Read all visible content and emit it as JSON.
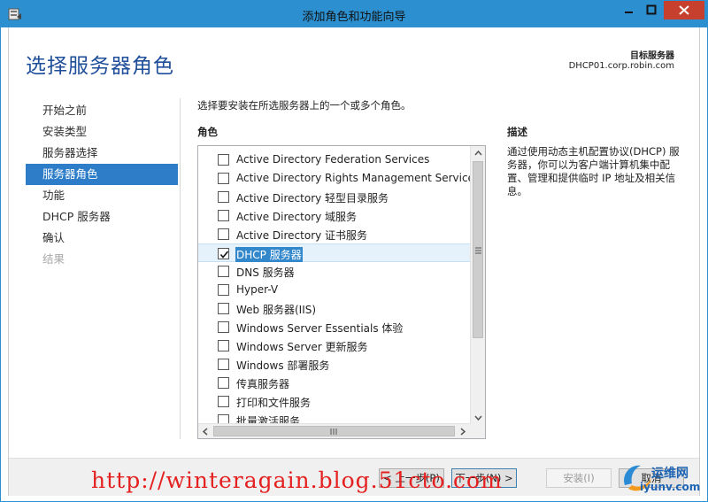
{
  "window": {
    "title": "添加角色和功能向导"
  },
  "header": {
    "page_title": "选择服务器角色",
    "target_label": "目标服务器",
    "target_server": "DHCP01.corp.robin.com"
  },
  "nav": {
    "items": [
      {
        "label": "开始之前",
        "state": "normal"
      },
      {
        "label": "安装类型",
        "state": "normal"
      },
      {
        "label": "服务器选择",
        "state": "normal"
      },
      {
        "label": "服务器角色",
        "state": "active"
      },
      {
        "label": "功能",
        "state": "normal"
      },
      {
        "label": "DHCP 服务器",
        "state": "normal"
      },
      {
        "label": "确认",
        "state": "normal"
      },
      {
        "label": "结果",
        "state": "disabled"
      }
    ]
  },
  "main": {
    "intro": "选择要安装在所选服务器上的一个或多个角色。",
    "roles_header": "角色",
    "roles": [
      {
        "label": "Active Directory Federation Services",
        "checked": false,
        "selected": false
      },
      {
        "label": "Active Directory Rights Management Services",
        "checked": false,
        "selected": false
      },
      {
        "label": "Active Directory 轻型目录服务",
        "checked": false,
        "selected": false
      },
      {
        "label": "Active Directory 域服务",
        "checked": false,
        "selected": false
      },
      {
        "label": "Active Directory 证书服务",
        "checked": false,
        "selected": false
      },
      {
        "label": "DHCP 服务器",
        "checked": true,
        "selected": true
      },
      {
        "label": "DNS 服务器",
        "checked": false,
        "selected": false
      },
      {
        "label": "Hyper-V",
        "checked": false,
        "selected": false
      },
      {
        "label": "Web 服务器(IIS)",
        "checked": false,
        "selected": false
      },
      {
        "label": "Windows Server Essentials 体验",
        "checked": false,
        "selected": false
      },
      {
        "label": "Windows Server 更新服务",
        "checked": false,
        "selected": false
      },
      {
        "label": "Windows 部署服务",
        "checked": false,
        "selected": false
      },
      {
        "label": "传真服务器",
        "checked": false,
        "selected": false
      },
      {
        "label": "打印和文件服务",
        "checked": false,
        "selected": false
      },
      {
        "label": "批量激活服务",
        "checked": false,
        "selected": false
      }
    ],
    "description_header": "描述",
    "description": "通过使用动态主机配置协议(DHCP) 服务器，你可以为客户端计算机集中配置、管理和提供临时 IP 地址及相关信息。"
  },
  "footer": {
    "prev_label": "< 上一步(P)",
    "next_label": "下一步(N) >",
    "install_label": "安装(I)",
    "cancel_label": "取消"
  },
  "watermark": {
    "url": "http://winteragain.blog.51cto.com",
    "logo_cn": "运维网",
    "logo_en": "iyunv.com"
  },
  "colors": {
    "titlebar": "#2b8fd0",
    "close_button": "#c7402e",
    "nav_active": "#2e7dc8",
    "page_title": "#1f4e9a",
    "watermark": "#e52020"
  }
}
